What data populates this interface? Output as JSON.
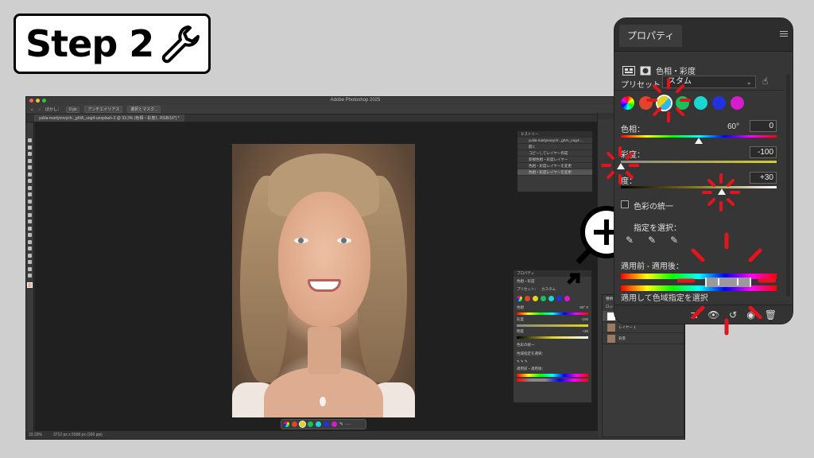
{
  "badge": {
    "label": "Step 2"
  },
  "photoshop": {
    "app_title": "Adobe Photoshop 2025",
    "document_tab": "yuliia-martynovych-_gtVA_uog4-unsplash-2 @ 33.3% (色相・彩度1, RGB/16*) *",
    "options": {
      "blur": "ぼかし：",
      "blur_value": "0 px",
      "antialias": "アンチエイリアス",
      "select_mask": "選択とマスク..."
    },
    "status": {
      "zoom": "33.33%",
      "doc_size": "3712 px x 5568 px (300 ppi)"
    },
    "history": {
      "title": "ヒストリー",
      "snapshot": "yuliia-martynovych-_gtVA_uog4-...",
      "items": [
        "開く",
        "コピーしてレイヤー作成",
        "新規色相・彩度レイヤー",
        "色相・彩度レイヤーを変更",
        "色相・彩度レイヤーを変更"
      ]
    },
    "mini_properties": {
      "title": "プロパティ",
      "adj": "色相・彩度",
      "preset": "プリセット：",
      "preset_value": "カスタム",
      "hue": "色相",
      "hue_value": "60°",
      "hue_num": "0",
      "sat": "彩度",
      "sat_value": "-100",
      "light": "明度",
      "light_value": "+30",
      "colorize": "色彩の統一",
      "pick": "色域指定を選択：",
      "range": "適用前・適用後："
    },
    "layers": {
      "kind_label": "種類",
      "lock_label": "ロック：",
      "items": [
        {
          "name": "色相・彩度 1"
        },
        {
          "name": "レイヤー 1"
        },
        {
          "name": "背景"
        }
      ]
    }
  },
  "properties": {
    "title": "プロパティ",
    "adjustment_name": "色相・彩度",
    "preset_label": "プリセット：",
    "preset_value": "スタム",
    "hue_label": "色相：",
    "hue_degree": "60°",
    "hue_value": "0",
    "saturation_label": "彩度：",
    "saturation_value": "-100",
    "lightness_label": "度：",
    "lightness_value": "+30",
    "colorize_label": "色彩の統一",
    "select_range_label": "指定を選択：",
    "before_after_label": "適用前 - 適用後：",
    "bottom_label": "適用して色域指定を選択",
    "channel_colors": [
      "#e0442a",
      "#2fb8ea",
      "#18c15a",
      "#19d7d2",
      "#2431e0",
      "#d61ccf"
    ]
  },
  "colors": {
    "accent_red": "#e3141b"
  }
}
